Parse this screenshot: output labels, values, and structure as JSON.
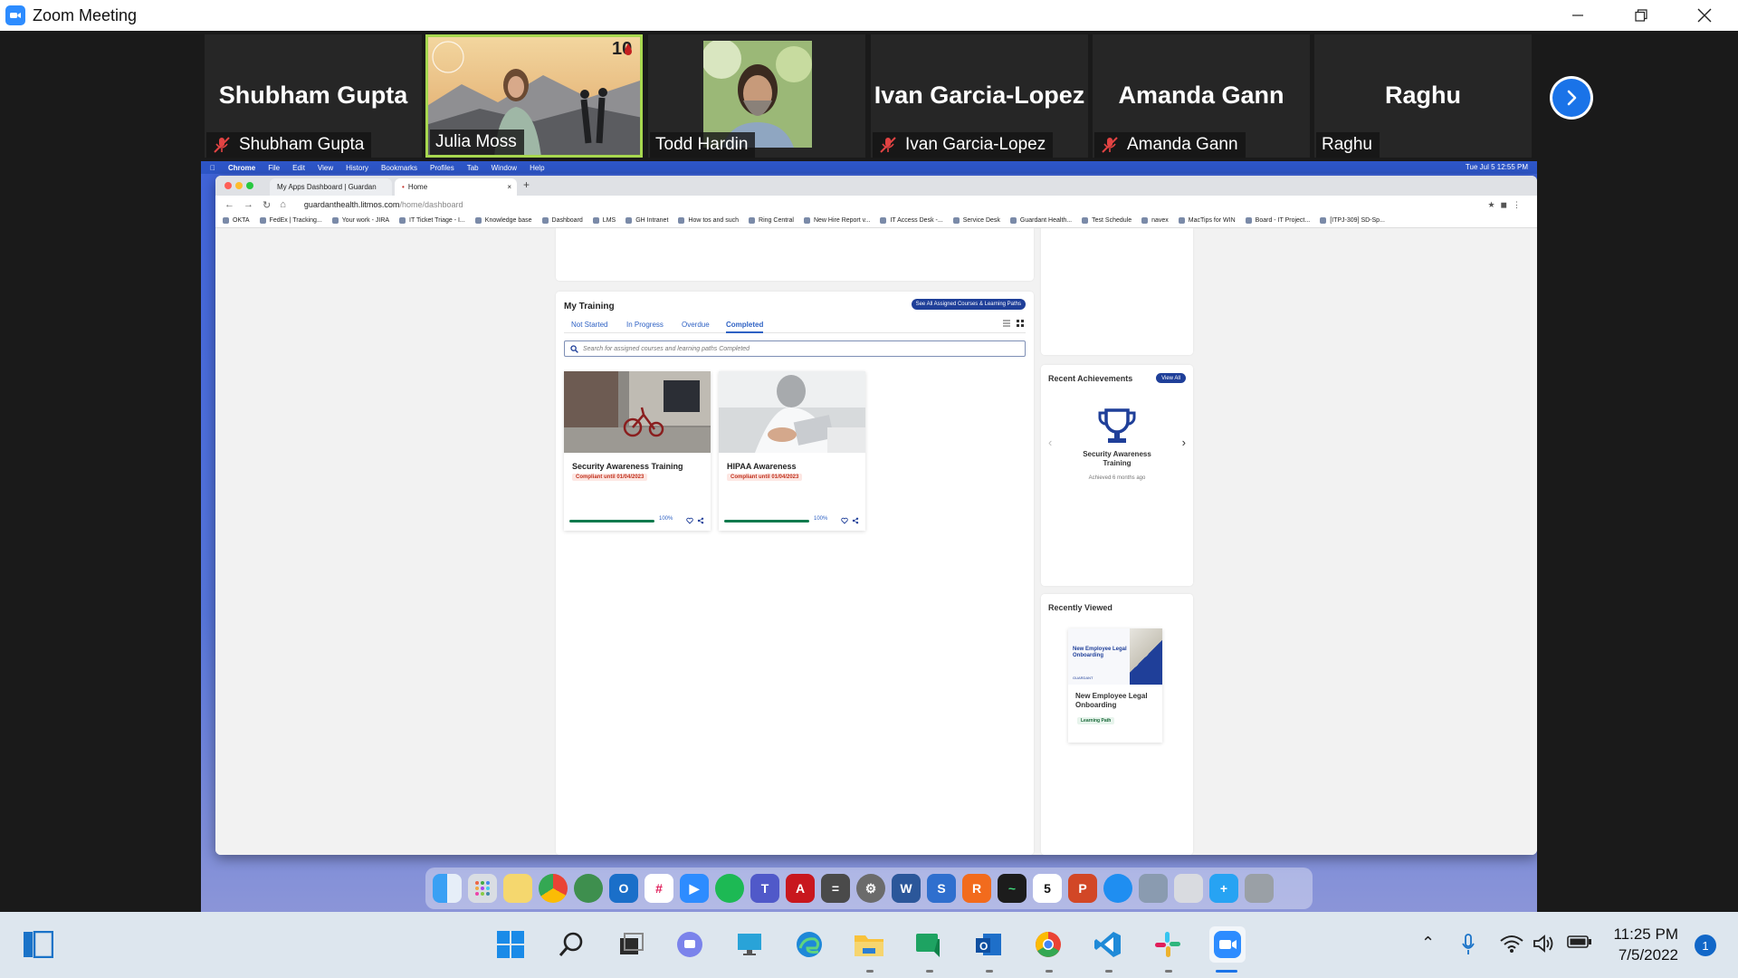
{
  "window": {
    "title": "Zoom Meeting"
  },
  "participants": [
    {
      "big_name": "Shubham Gupta",
      "label": "Shubham Gupta",
      "muted": true,
      "video": false
    },
    {
      "big_name": "",
      "label": "Julia Moss",
      "muted": false,
      "video": true,
      "active": true
    },
    {
      "big_name": "",
      "label": "Todd Hardin",
      "muted": false,
      "video": true
    },
    {
      "big_name": "Ivan Garcia-Lopez",
      "label": "Ivan Garcia-Lopez",
      "muted": true,
      "video": false
    },
    {
      "big_name": "Amanda Gann",
      "label": "Amanda Gann",
      "muted": true,
      "video": false
    },
    {
      "big_name": "Raghu",
      "label": "Raghu",
      "muted": false,
      "video": false
    }
  ],
  "mac_menu": {
    "items": [
      "Chrome",
      "File",
      "Edit",
      "View",
      "History",
      "Bookmarks",
      "Profiles",
      "Tab",
      "Window",
      "Help"
    ],
    "clock": "Tue Jul 5  12:55 PM"
  },
  "browser": {
    "tabs": [
      "My Apps Dashboard | Guardan",
      "Home"
    ],
    "url_host": "guardanthealth.litmos.com",
    "url_path": "/home/dashboard",
    "bookmarks": [
      "OKTA",
      "FedEx | Tracking...",
      "Your work - JIRA",
      "IT Ticket Triage - I...",
      "Knowledge base",
      "Dashboard",
      "LMS",
      "GH Intranet",
      "How tos and such",
      "Ring Central",
      "New Hire Report v...",
      "IT Access Desk -...",
      "Service Desk",
      "Guardant Health...",
      "Test Schedule",
      "navex",
      "MacTips for WIN",
      "Board - IT Project...",
      "[ITPJ-309] SD-Sp..."
    ]
  },
  "training": {
    "title": "My Training",
    "see_all": "See All Assigned Courses & Learning Paths",
    "tabs": [
      "Not Started",
      "In Progress",
      "Overdue",
      "Completed"
    ],
    "selected_tab": "Completed",
    "search_placeholder": "Search for assigned courses and learning paths Completed",
    "courses": [
      {
        "name": "Security Awareness Training",
        "badge": "Compliant until 01/04/2023",
        "progress": "100%"
      },
      {
        "name": "HIPAA Awareness",
        "badge": "Compliant until 01/04/2023",
        "progress": "100%"
      }
    ]
  },
  "achievements": {
    "title": "Recent Achievements",
    "view_all": "View All",
    "item_name": "Security Awareness Training",
    "item_date": "Achieved 6 months ago"
  },
  "recently_viewed": {
    "title": "Recently Viewed",
    "thumb_title": "New Employee Legal Onboarding",
    "thumb_brand": "GUARDANT",
    "name": "New Employee Legal Onboarding",
    "type": "Learning Path"
  },
  "taskbar": {
    "time": "11:25 PM",
    "date": "7/5/2022",
    "notifications": "1"
  },
  "colors": {
    "zoom_blue": "#2d8cff",
    "accent_navy": "#1f3f99",
    "active_speaker": "#a7d74f"
  }
}
